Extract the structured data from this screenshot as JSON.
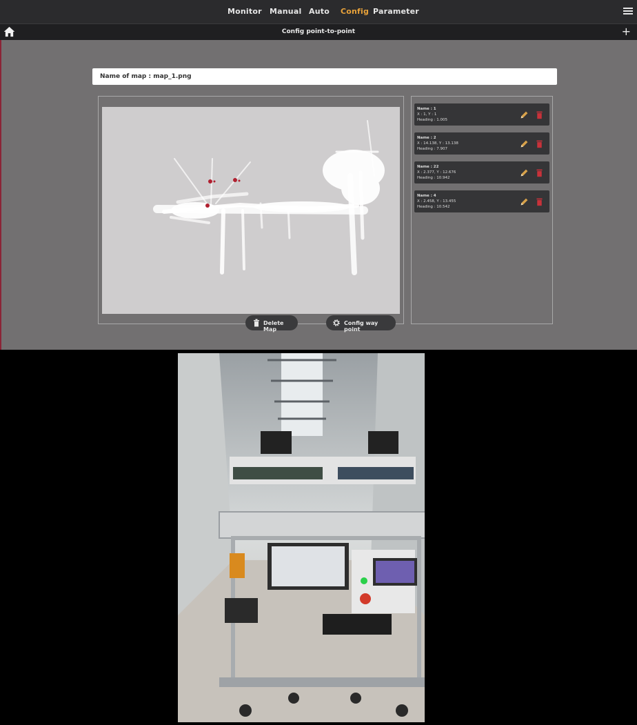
{
  "nav": {
    "items": [
      {
        "label": "Monitor"
      },
      {
        "label": "Manual"
      },
      {
        "label": "Auto"
      },
      {
        "label": "Config"
      },
      {
        "label": "Parameter"
      }
    ],
    "active": "Config"
  },
  "subheader": {
    "title": "Config point-to-point"
  },
  "map": {
    "name_label": "Name of map : map_1.png"
  },
  "buttons": {
    "delete_map": "Delete Map",
    "config_way_point": "Config way point"
  },
  "waypoints": [
    {
      "name": "Name : 1",
      "xy": "X : 1, Y : 1",
      "heading": "Heading : 1.005"
    },
    {
      "name": "Name : 2",
      "xy": "X : 14.138, Y : 13.138",
      "heading": "Heading : 7.907"
    },
    {
      "name": "Name : 22",
      "xy": "X : 2.377, Y : 12.676",
      "heading": "Heading : 10.942"
    },
    {
      "name": "Name : 4",
      "xy": "X : 2.458, Y : 13.455",
      "heading": "Heading : 10.542"
    }
  ],
  "colors": {
    "accent": "#e8a23a",
    "topbar": "#2b2b2d",
    "panel_bg": "#727071",
    "card_bg": "#353537",
    "delete_red": "#c8323a"
  },
  "icons": {
    "home": "home-icon",
    "menu": "hamburger-menu-icon",
    "add": "plus-icon",
    "edit": "pencil-icon",
    "delete": "trash-icon",
    "settings": "gear-icon"
  }
}
